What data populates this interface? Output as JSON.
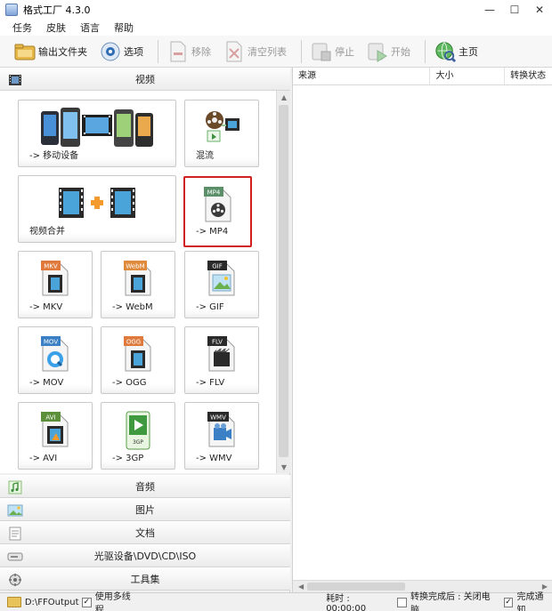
{
  "window": {
    "title": "格式工厂 4.3.0"
  },
  "menu": [
    "任务",
    "皮肤",
    "语言",
    "帮助"
  ],
  "toolbar": {
    "output_folder": "输出文件夹",
    "options": "选项",
    "remove": "移除",
    "clear_list": "清空列表",
    "stop": "停止",
    "start": "开始",
    "home": "主页"
  },
  "categories": {
    "video": "视频",
    "audio": "音频",
    "image": "图片",
    "document": "文档",
    "optical": "光驱设备\\DVD\\CD\\ISO",
    "tools": "工具集"
  },
  "tiles": {
    "mobile": "-> 移动设备",
    "mix": "混流",
    "merge": "视频合并",
    "mp4": "-> MP4",
    "mkv": "-> MKV",
    "webm": "-> WebM",
    "gif": "-> GIF",
    "mov": "-> MOV",
    "ogg": "-> OGG",
    "flv": "-> FLV",
    "avi": "-> AVI",
    "3gp": "-> 3GP",
    "wmv": "-> WMV"
  },
  "badges": {
    "mp4": "MP4",
    "mkv": "MKV",
    "webm": "WebM",
    "gif": "GIF",
    "mov": "MOV",
    "ogg": "OGG",
    "flv": "FLV",
    "avi": "AVI",
    "3gp": "3GP",
    "wmv": "WMV"
  },
  "list_columns": [
    "来源",
    "大小",
    "转换状态"
  ],
  "status": {
    "output_path": "D:\\FFOutput",
    "multithread": "使用多线程",
    "elapsed": "耗时 : 00:00:00",
    "after_convert": "转换完成后 : 关闭电脑",
    "notify": "完成通知"
  },
  "colors": {
    "selected_border": "#d02020",
    "accent": "#2f6db5"
  }
}
